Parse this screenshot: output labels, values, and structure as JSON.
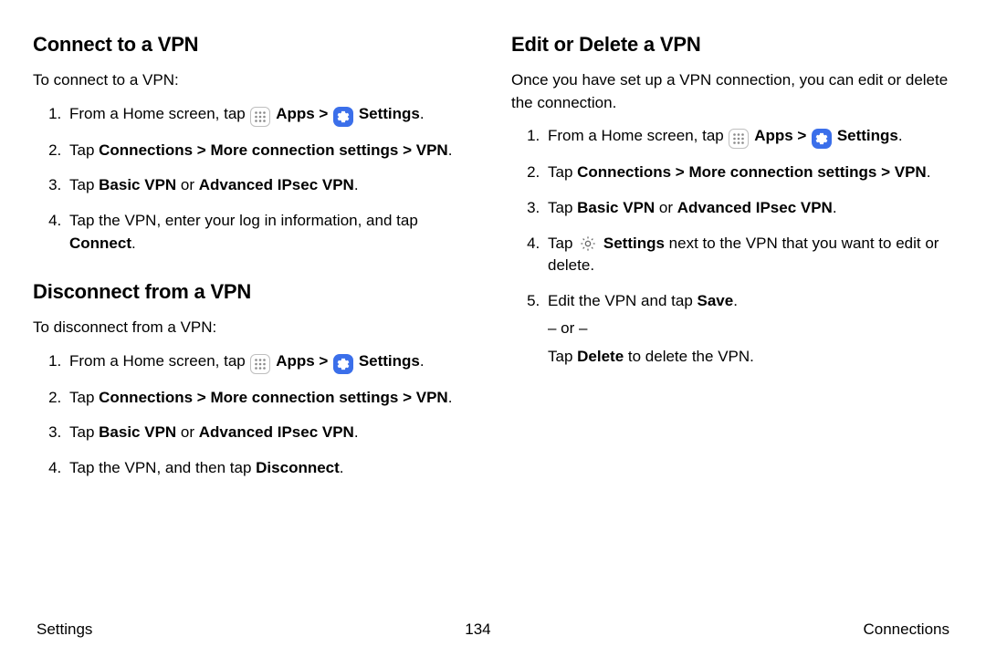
{
  "left": {
    "section1": {
      "heading": "Connect to a VPN",
      "intro": "To connect to a VPN:",
      "step1_a": "From a Home screen, tap ",
      "step1_apps": "Apps",
      "step1_arrow": " > ",
      "step1_settings": "Settings",
      "step1_end": ".",
      "step2_a": "Tap ",
      "step2_b": "Connections > More connection settings > VPN",
      "step2_c": ".",
      "step3_a": "Tap ",
      "step3_b": "Basic VPN",
      "step3_c": " or ",
      "step3_d": "Advanced IPsec VPN",
      "step3_e": ".",
      "step4_a": "Tap the VPN, enter your log in information, and tap ",
      "step4_b": "Connect",
      "step4_c": "."
    },
    "section2": {
      "heading": "Disconnect from a VPN",
      "intro": "To disconnect from a VPN:",
      "step1_a": "From a Home screen, tap ",
      "step1_apps": "Apps",
      "step1_arrow": " > ",
      "step1_settings": "Settings",
      "step1_end": ".",
      "step2_a": "Tap ",
      "step2_b": "Connections > More connection settings > VPN",
      "step2_c": ".",
      "step3_a": "Tap ",
      "step3_b": "Basic VPN",
      "step3_c": " or ",
      "step3_d": "Advanced IPsec VPN",
      "step3_e": ".",
      "step4_a": "Tap the VPN, and then tap ",
      "step4_b": "Disconnect",
      "step4_c": "."
    }
  },
  "right": {
    "section1": {
      "heading": "Edit or Delete a VPN",
      "intro": "Once you have set up a VPN connection, you can edit or delete the connection.",
      "step1_a": "From a Home screen, tap ",
      "step1_apps": "Apps",
      "step1_arrow": " > ",
      "step1_settings": "Settings",
      "step1_end": ".",
      "step2_a": "Tap ",
      "step2_b": "Connections > More connection settings > VPN",
      "step2_c": ".",
      "step3_a": "Tap ",
      "step3_b": "Basic VPN",
      "step3_c": " or ",
      "step3_d": "Advanced IPsec VPN",
      "step3_e": ".",
      "step4_a": "Tap ",
      "step4_b": "Settings",
      "step4_c": " next to the VPN that you want to edit or delete.",
      "step5_a": "Edit the VPN and tap ",
      "step5_b": "Save",
      "step5_c": ".",
      "step5_or": "– or –",
      "step5_d": "Tap ",
      "step5_e": "Delete",
      "step5_f": " to delete the VPN."
    }
  },
  "footer": {
    "left": "Settings",
    "center": "134",
    "right": "Connections"
  }
}
